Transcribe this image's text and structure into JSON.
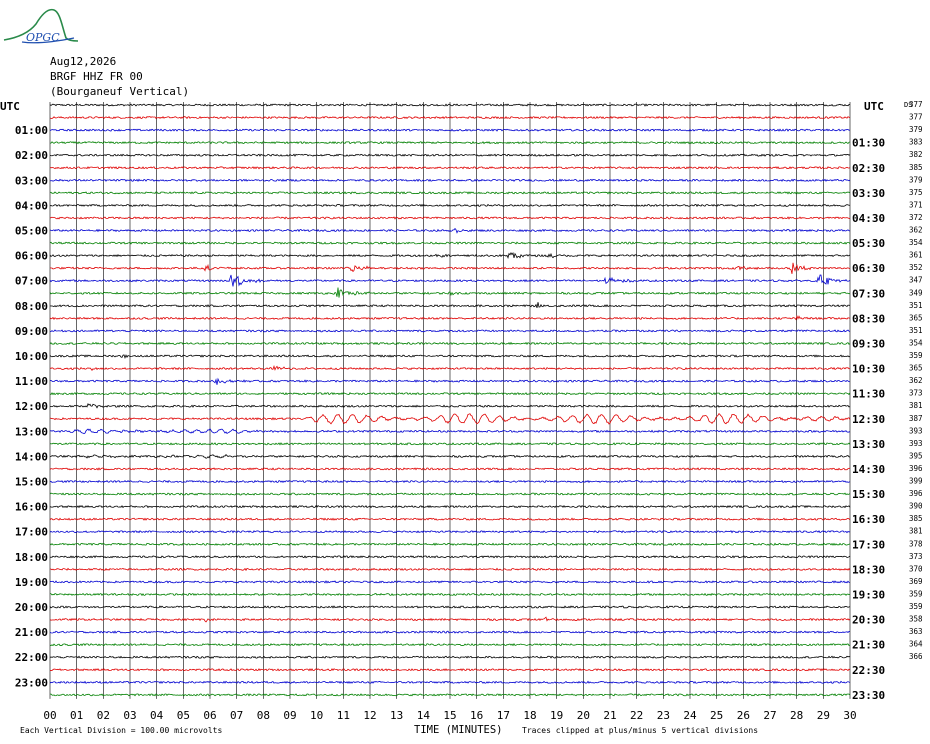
{
  "header": {
    "logo_text": "OPGC",
    "date": "Aug12,2026",
    "station": "BRGF HHZ FR 00",
    "location": "(Bourganeuf Vertical)",
    "utc_left": "UTC",
    "utc_right": "UTC",
    "ds_label": "DS"
  },
  "footer": {
    "vertical_division": "Each Vertical Division =  100.00 microvolts",
    "xlabel": "TIME (MINUTES)",
    "clip_note": "Traces clipped at plus/minus 5 vertical divisions"
  },
  "colors": {
    "trace_cycle": [
      "#000000",
      "#e00000",
      "#0000d0",
      "#008000"
    ],
    "grid": "#000000",
    "logo_green": "#2a8a4a",
    "logo_blue": "#2050b0"
  },
  "chart_data": {
    "type": "line",
    "title": "",
    "xlabel": "TIME (MINUTES)",
    "ylabel": "",
    "xlim": [
      0,
      30
    ],
    "x_ticks": [
      "00",
      "01",
      "02",
      "03",
      "04",
      "05",
      "06",
      "07",
      "08",
      "09",
      "10",
      "11",
      "12",
      "13",
      "14",
      "15",
      "16",
      "17",
      "18",
      "19",
      "20",
      "21",
      "22",
      "23",
      "24",
      "25",
      "26",
      "27",
      "28",
      "29",
      "30"
    ],
    "left_hour_labels": [
      "01:00",
      "02:00",
      "03:00",
      "04:00",
      "05:00",
      "06:00",
      "07:00",
      "08:00",
      "09:00",
      "10:00",
      "11:00",
      "12:00",
      "13:00",
      "14:00",
      "15:00",
      "16:00",
      "17:00",
      "18:00",
      "19:00",
      "20:00",
      "21:00",
      "22:00",
      "23:00"
    ],
    "right_hour_labels": [
      "01:30",
      "02:30",
      "03:30",
      "04:30",
      "05:30",
      "06:30",
      "07:30",
      "08:30",
      "09:30",
      "10:30",
      "11:30",
      "12:30",
      "13:30",
      "14:30",
      "15:30",
      "16:30",
      "17:30",
      "18:30",
      "19:30",
      "20:30",
      "21:30",
      "22:30",
      "23:30"
    ],
    "ds_values": [
      377,
      377,
      379,
      383,
      382,
      385,
      379,
      375,
      371,
      372,
      362,
      354,
      361,
      352,
      347,
      349,
      351,
      365,
      351,
      354,
      359,
      365,
      362,
      373,
      381,
      387,
      393,
      393,
      395,
      396,
      399,
      396,
      390,
      385,
      381,
      378,
      373,
      370,
      369,
      359,
      359,
      358,
      363,
      364,
      366
    ],
    "trace_count": 48,
    "grid": true,
    "events": [
      {
        "trace": 10,
        "minute": 15.2,
        "amp": 2.0,
        "dur": 0.5
      },
      {
        "trace": 12,
        "minute": 14.5,
        "amp": 1.6,
        "dur": 1.0
      },
      {
        "trace": 12,
        "minute": 17.2,
        "amp": 4.5,
        "dur": 1.2
      },
      {
        "trace": 12,
        "minute": 18.7,
        "amp": 2.0,
        "dur": 0.8
      },
      {
        "trace": 13,
        "minute": 5.8,
        "amp": 2.5,
        "dur": 1.2
      },
      {
        "trace": 13,
        "minute": 11.3,
        "amp": 3.0,
        "dur": 1.8
      },
      {
        "trace": 13,
        "minute": 25.8,
        "amp": 2.5,
        "dur": 0.8
      },
      {
        "trace": 13,
        "minute": 27.8,
        "amp": 5.5,
        "dur": 1.0
      },
      {
        "trace": 14,
        "minute": 6.8,
        "amp": 9.0,
        "dur": 1.2
      },
      {
        "trace": 14,
        "minute": 20.8,
        "amp": 3.5,
        "dur": 1.5
      },
      {
        "trace": 14,
        "minute": 28.8,
        "amp": 6.0,
        "dur": 1.5
      },
      {
        "trace": 15,
        "minute": 10.8,
        "amp": 5.0,
        "dur": 1.5
      },
      {
        "trace": 15,
        "minute": 15.0,
        "amp": 1.5,
        "dur": 0.5
      },
      {
        "trace": 16,
        "minute": 18.3,
        "amp": 2.5,
        "dur": 0.4
      },
      {
        "trace": 17,
        "minute": 28.0,
        "amp": 3.0,
        "dur": 0.5
      },
      {
        "trace": 20,
        "minute": 2.7,
        "amp": 1.5,
        "dur": 0.8
      },
      {
        "trace": 21,
        "minute": 8.4,
        "amp": 3.0,
        "dur": 0.8
      },
      {
        "trace": 21,
        "minute": 1.5,
        "amp": 1.2,
        "dur": 0.6
      },
      {
        "trace": 22,
        "minute": 6.2,
        "amp": 3.0,
        "dur": 1.2
      },
      {
        "trace": 24,
        "minute": 1.4,
        "amp": 3.5,
        "dur": 1.2
      },
      {
        "trace": 41,
        "minute": 5.8,
        "amp": 1.8,
        "dur": 0.6
      },
      {
        "trace": 41,
        "minute": 18.6,
        "amp": 1.5,
        "dur": 0.6
      }
    ],
    "surface_waves": [
      {
        "trace": 25,
        "start": 9.0,
        "end": 30.0,
        "amp": 4.0,
        "period": 0.55
      },
      {
        "trace": 26,
        "start": 0.0,
        "end": 10.0,
        "amp": 1.6,
        "period": 0.45
      },
      {
        "trace": 28,
        "start": 0.5,
        "end": 8.0,
        "amp": 0.9,
        "period": 0.5
      }
    ]
  }
}
